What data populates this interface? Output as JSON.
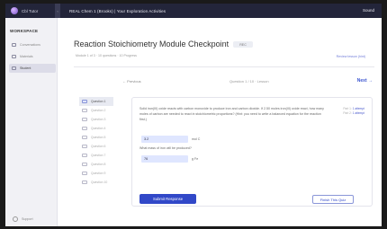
{
  "topbar": {
    "brand": "Cbl Tutor",
    "collapse_icon": "chevron-left-icon",
    "course_title": "REAL Chem 1 (Brooks) | Your Exploration Activities",
    "user": "Sound"
  },
  "sidebar": {
    "section_label": "WORKSPACE",
    "items": [
      {
        "label": "Conversations",
        "icon": "chat-icon"
      },
      {
        "label": "Materials",
        "icon": "document-icon"
      },
      {
        "label": "Student",
        "icon": "student-icon"
      }
    ],
    "support": {
      "label": "Support",
      "icon": "help-icon"
    }
  },
  "main": {
    "title": "Reaction Stoichiometry Module Checkpoint",
    "pill": "REC",
    "subline": "Module 1 of 3  ·  10 questions  ·  10 Progress",
    "review_link": "Review lesson (hint)",
    "prev_label": "← Previous",
    "counter": "Question 1 / 10 · Lesson",
    "next_label": "Next →"
  },
  "questions": [
    "Question 1",
    "Question 2",
    "Question 3",
    "Question 4",
    "Question 5",
    "Question 6",
    "Question 7",
    "Question 8",
    "Question 9",
    "Question 10"
  ],
  "card": {
    "prompt": "Solid iron(III) oxide reacts with carbon monoxide to produce iron and carbon dioxide. If 2.50 moles iron(III) oxide react, how many moles of carbon are needed to react in stoichiometric proportions? (Hint: you need to write a balanced equation for the reaction first.)",
    "answer1": "3.2",
    "unit1": "mol C",
    "prompt2": "What mass of iron will be produced?",
    "answer2": "76",
    "unit2": "g Fe",
    "legend_line1": "Part 1:",
    "legend_val1": "1 attempt",
    "legend_line2": "Part 2:",
    "legend_val2": "1 attempt"
  },
  "buttons": {
    "submit": "Submit Response",
    "finish": "Finish This Quiz"
  }
}
